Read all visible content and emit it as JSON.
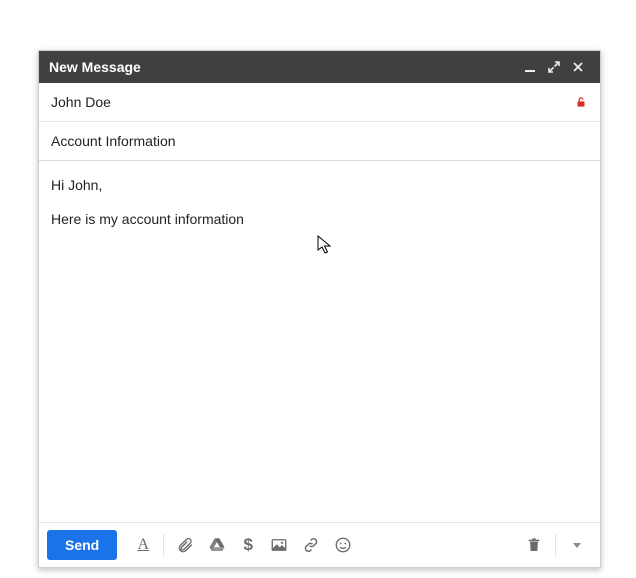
{
  "titlebar": {
    "title": "New Message"
  },
  "fields": {
    "to": "John Doe",
    "subject": "Account Information"
  },
  "body": {
    "line1": "Hi John,",
    "line2": "Here is my account information"
  },
  "toolbar": {
    "send_label": "Send",
    "format_glyph": "A",
    "money_glyph": "$"
  },
  "icons": {
    "minimize": "minimize-icon",
    "fullscreen": "fullscreen-icon",
    "close": "close-icon",
    "lock": "lock-open-icon",
    "format": "format-icon",
    "attach": "paperclip-icon",
    "drive": "drive-icon",
    "money": "dollar-icon",
    "photo": "photo-icon",
    "link": "link-icon",
    "emoji": "emoji-icon",
    "trash": "trash-icon",
    "more": "more-arrow-icon"
  },
  "colors": {
    "titlebar_bg": "#404040",
    "send_bg": "#1a73e8",
    "lock_color": "#d93025",
    "icon_color": "#6b6b6b"
  }
}
